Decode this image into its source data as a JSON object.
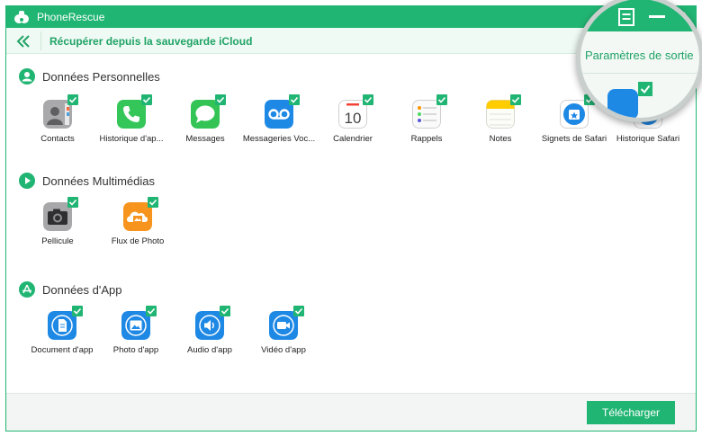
{
  "window": {
    "title": "PhoneRescue"
  },
  "header": {
    "breadcrumb": "Récupérer depuis la sauvegarde iCloud"
  },
  "magnifier": {
    "settings_label": "Paramètres de sortie"
  },
  "sections": [
    {
      "title": "Données Personnelles",
      "icon": "person-icon",
      "items": [
        {
          "label": "Contacts",
          "icon": "contacts-icon",
          "checked": true
        },
        {
          "label": "Historique d'ap...",
          "icon": "phone-icon",
          "checked": true
        },
        {
          "label": "Messages",
          "icon": "messages-icon",
          "checked": true
        },
        {
          "label": "Messageries Voc...",
          "icon": "voicemail-icon",
          "checked": true
        },
        {
          "label": "Calendrier",
          "icon": "calendar-icon",
          "checked": true,
          "calendar_day": "10"
        },
        {
          "label": "Rappels",
          "icon": "reminders-icon",
          "checked": true
        },
        {
          "label": "Notes",
          "icon": "notes-icon",
          "checked": true
        },
        {
          "label": "Signets de Safari",
          "icon": "safari-bookmarks-icon",
          "checked": true
        },
        {
          "label": "Historique Safari",
          "icon": "safari-history-icon",
          "checked": true
        }
      ]
    },
    {
      "title": "Données Multimédias",
      "icon": "play-icon",
      "items": [
        {
          "label": "Pellicule",
          "icon": "camera-icon",
          "checked": true
        },
        {
          "label": "Flux de Photo",
          "icon": "photo-stream-icon",
          "checked": true
        }
      ]
    },
    {
      "title": "Données d'App",
      "icon": "app-store-icon",
      "items": [
        {
          "label": "Document d'app",
          "icon": "app-document-icon",
          "checked": true
        },
        {
          "label": "Photo d'app",
          "icon": "app-photo-icon",
          "checked": true
        },
        {
          "label": "Audio d'app",
          "icon": "app-audio-icon",
          "checked": true
        },
        {
          "label": "Vidéo d'app",
          "icon": "app-video-icon",
          "checked": true
        }
      ]
    }
  ],
  "footer": {
    "download_label": "Télécharger"
  },
  "colors": {
    "accent": "#21b573",
    "accent_text": "#21a366",
    "header_bg": "#effaf4"
  }
}
